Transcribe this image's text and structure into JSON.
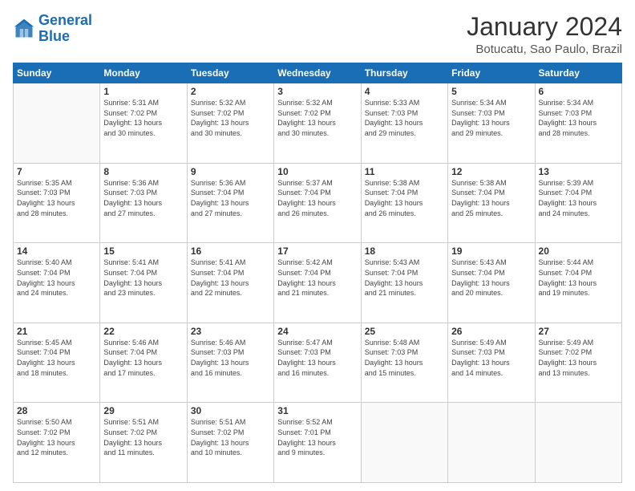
{
  "logo": {
    "line1": "General",
    "line2": "Blue"
  },
  "header": {
    "title": "January 2024",
    "subtitle": "Botucatu, Sao Paulo, Brazil"
  },
  "weekdays": [
    "Sunday",
    "Monday",
    "Tuesday",
    "Wednesday",
    "Thursday",
    "Friday",
    "Saturday"
  ],
  "weeks": [
    [
      {
        "day": "",
        "info": ""
      },
      {
        "day": "1",
        "info": "Sunrise: 5:31 AM\nSunset: 7:02 PM\nDaylight: 13 hours\nand 30 minutes."
      },
      {
        "day": "2",
        "info": "Sunrise: 5:32 AM\nSunset: 7:02 PM\nDaylight: 13 hours\nand 30 minutes."
      },
      {
        "day": "3",
        "info": "Sunrise: 5:32 AM\nSunset: 7:02 PM\nDaylight: 13 hours\nand 30 minutes."
      },
      {
        "day": "4",
        "info": "Sunrise: 5:33 AM\nSunset: 7:03 PM\nDaylight: 13 hours\nand 29 minutes."
      },
      {
        "day": "5",
        "info": "Sunrise: 5:34 AM\nSunset: 7:03 PM\nDaylight: 13 hours\nand 29 minutes."
      },
      {
        "day": "6",
        "info": "Sunrise: 5:34 AM\nSunset: 7:03 PM\nDaylight: 13 hours\nand 28 minutes."
      }
    ],
    [
      {
        "day": "7",
        "info": "Sunrise: 5:35 AM\nSunset: 7:03 PM\nDaylight: 13 hours\nand 28 minutes."
      },
      {
        "day": "8",
        "info": "Sunrise: 5:36 AM\nSunset: 7:03 PM\nDaylight: 13 hours\nand 27 minutes."
      },
      {
        "day": "9",
        "info": "Sunrise: 5:36 AM\nSunset: 7:04 PM\nDaylight: 13 hours\nand 27 minutes."
      },
      {
        "day": "10",
        "info": "Sunrise: 5:37 AM\nSunset: 7:04 PM\nDaylight: 13 hours\nand 26 minutes."
      },
      {
        "day": "11",
        "info": "Sunrise: 5:38 AM\nSunset: 7:04 PM\nDaylight: 13 hours\nand 26 minutes."
      },
      {
        "day": "12",
        "info": "Sunrise: 5:38 AM\nSunset: 7:04 PM\nDaylight: 13 hours\nand 25 minutes."
      },
      {
        "day": "13",
        "info": "Sunrise: 5:39 AM\nSunset: 7:04 PM\nDaylight: 13 hours\nand 24 minutes."
      }
    ],
    [
      {
        "day": "14",
        "info": "Sunrise: 5:40 AM\nSunset: 7:04 PM\nDaylight: 13 hours\nand 24 minutes."
      },
      {
        "day": "15",
        "info": "Sunrise: 5:41 AM\nSunset: 7:04 PM\nDaylight: 13 hours\nand 23 minutes."
      },
      {
        "day": "16",
        "info": "Sunrise: 5:41 AM\nSunset: 7:04 PM\nDaylight: 13 hours\nand 22 minutes."
      },
      {
        "day": "17",
        "info": "Sunrise: 5:42 AM\nSunset: 7:04 PM\nDaylight: 13 hours\nand 21 minutes."
      },
      {
        "day": "18",
        "info": "Sunrise: 5:43 AM\nSunset: 7:04 PM\nDaylight: 13 hours\nand 21 minutes."
      },
      {
        "day": "19",
        "info": "Sunrise: 5:43 AM\nSunset: 7:04 PM\nDaylight: 13 hours\nand 20 minutes."
      },
      {
        "day": "20",
        "info": "Sunrise: 5:44 AM\nSunset: 7:04 PM\nDaylight: 13 hours\nand 19 minutes."
      }
    ],
    [
      {
        "day": "21",
        "info": "Sunrise: 5:45 AM\nSunset: 7:04 PM\nDaylight: 13 hours\nand 18 minutes."
      },
      {
        "day": "22",
        "info": "Sunrise: 5:46 AM\nSunset: 7:04 PM\nDaylight: 13 hours\nand 17 minutes."
      },
      {
        "day": "23",
        "info": "Sunrise: 5:46 AM\nSunset: 7:03 PM\nDaylight: 13 hours\nand 16 minutes."
      },
      {
        "day": "24",
        "info": "Sunrise: 5:47 AM\nSunset: 7:03 PM\nDaylight: 13 hours\nand 16 minutes."
      },
      {
        "day": "25",
        "info": "Sunrise: 5:48 AM\nSunset: 7:03 PM\nDaylight: 13 hours\nand 15 minutes."
      },
      {
        "day": "26",
        "info": "Sunrise: 5:49 AM\nSunset: 7:03 PM\nDaylight: 13 hours\nand 14 minutes."
      },
      {
        "day": "27",
        "info": "Sunrise: 5:49 AM\nSunset: 7:02 PM\nDaylight: 13 hours\nand 13 minutes."
      }
    ],
    [
      {
        "day": "28",
        "info": "Sunrise: 5:50 AM\nSunset: 7:02 PM\nDaylight: 13 hours\nand 12 minutes."
      },
      {
        "day": "29",
        "info": "Sunrise: 5:51 AM\nSunset: 7:02 PM\nDaylight: 13 hours\nand 11 minutes."
      },
      {
        "day": "30",
        "info": "Sunrise: 5:51 AM\nSunset: 7:02 PM\nDaylight: 13 hours\nand 10 minutes."
      },
      {
        "day": "31",
        "info": "Sunrise: 5:52 AM\nSunset: 7:01 PM\nDaylight: 13 hours\nand 9 minutes."
      },
      {
        "day": "",
        "info": ""
      },
      {
        "day": "",
        "info": ""
      },
      {
        "day": "",
        "info": ""
      }
    ]
  ]
}
